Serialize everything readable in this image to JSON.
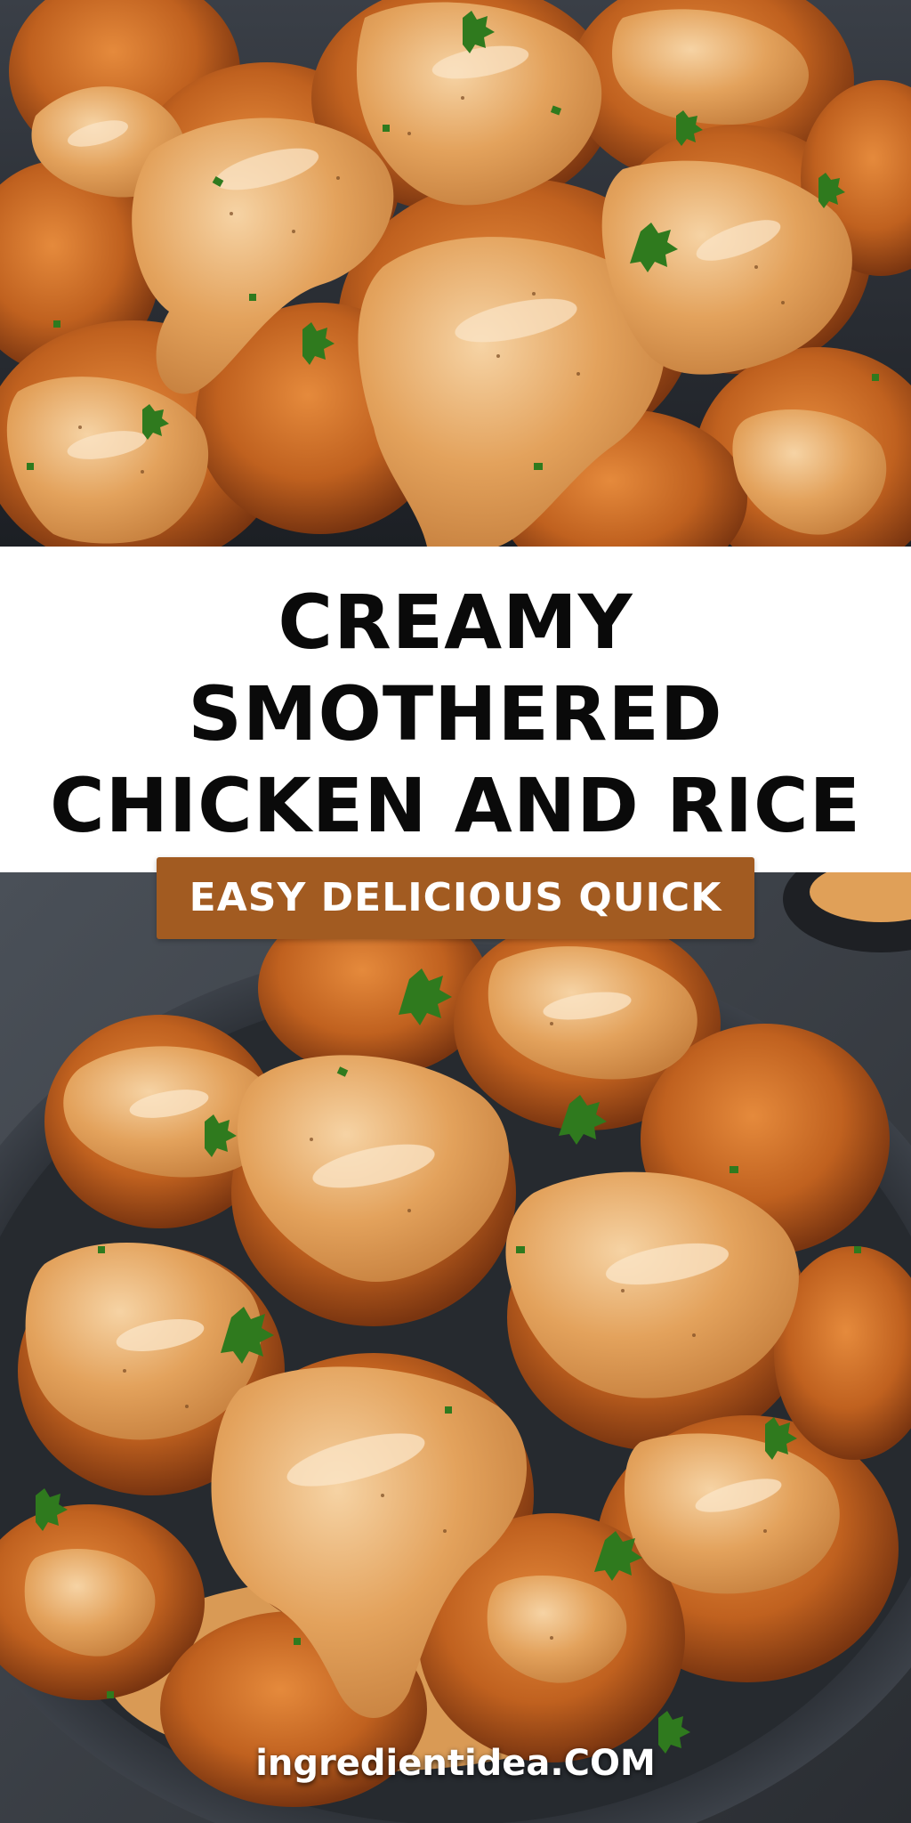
{
  "title": {
    "line1": "CREAMY",
    "line2": "SMOTHERED",
    "line3": "CHICKEN AND RICE"
  },
  "badge": {
    "text": "EASY DELICIOUS QUICK",
    "color": "#a25b21"
  },
  "footer": {
    "site": "ingredientidea.COM"
  },
  "colors": {
    "background": "#ffffff",
    "title_text": "#0a0a0a",
    "sauce": "#e2a058",
    "fried_crust": "#b8561c",
    "plate": "#2b2f35",
    "parsley": "#2f7a1e"
  }
}
